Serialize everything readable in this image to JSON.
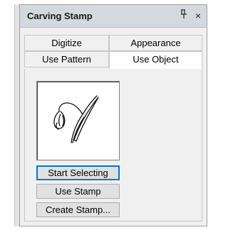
{
  "panel": {
    "title": "Carving Stamp",
    "pin_glyph": "̤",
    "close_glyph": "×"
  },
  "tabs": {
    "row1": [
      "Digitize",
      "Appearance"
    ],
    "row2": [
      "Use Pattern",
      "Use Object"
    ],
    "active": "Use Object"
  },
  "preview": {
    "icon": "snowdrop-stamp-icon"
  },
  "buttons": {
    "start_selecting": "Start Selecting",
    "use_stamp": "Use Stamp",
    "create_stamp": "Create Stamp..."
  },
  "colors": {
    "titlebar": "#d4d9e0",
    "panel": "#f0f0f0",
    "focus": "#0078d7"
  }
}
